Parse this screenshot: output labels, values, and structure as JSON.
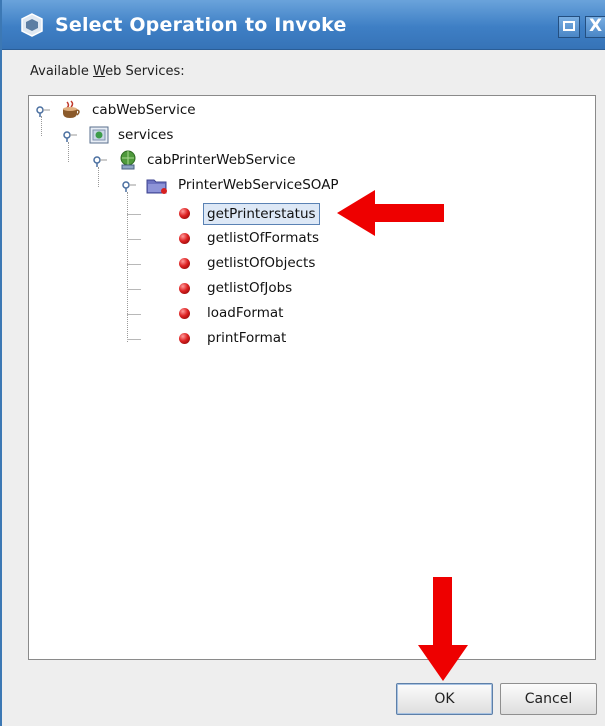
{
  "dialog": {
    "title": "Select Operation to Invoke",
    "close_glyph": "X",
    "colors": {
      "titlebar": "#3e7fc5",
      "selection": "#dde8f6",
      "arrow": "#ee0000"
    }
  },
  "services_label": {
    "before": "Available ",
    "mnemonic": "W",
    "after": "eb Services:"
  },
  "tree": {
    "root": "cabWebService",
    "services": "services",
    "service": "cabPrinterWebService",
    "port": "PrinterWebServiceSOAP",
    "operations": [
      "getPrinterstatus",
      "getlistOfFormats",
      "getlistOfObjects",
      "getlistOfJobs",
      "loadFormat",
      "printFormat"
    ],
    "selected_operation": "getPrinterstatus"
  },
  "buttons": {
    "ok": "OK",
    "cancel": "Cancel"
  },
  "icons": [
    "dialog-icon",
    "maximize-icon",
    "close-icon",
    "expand-handle-icon",
    "coffee-cup-icon",
    "services-icon",
    "web-service-icon",
    "folder-icon",
    "operation-bullet-icon",
    "arrow-left-icon",
    "arrow-down-icon"
  ]
}
